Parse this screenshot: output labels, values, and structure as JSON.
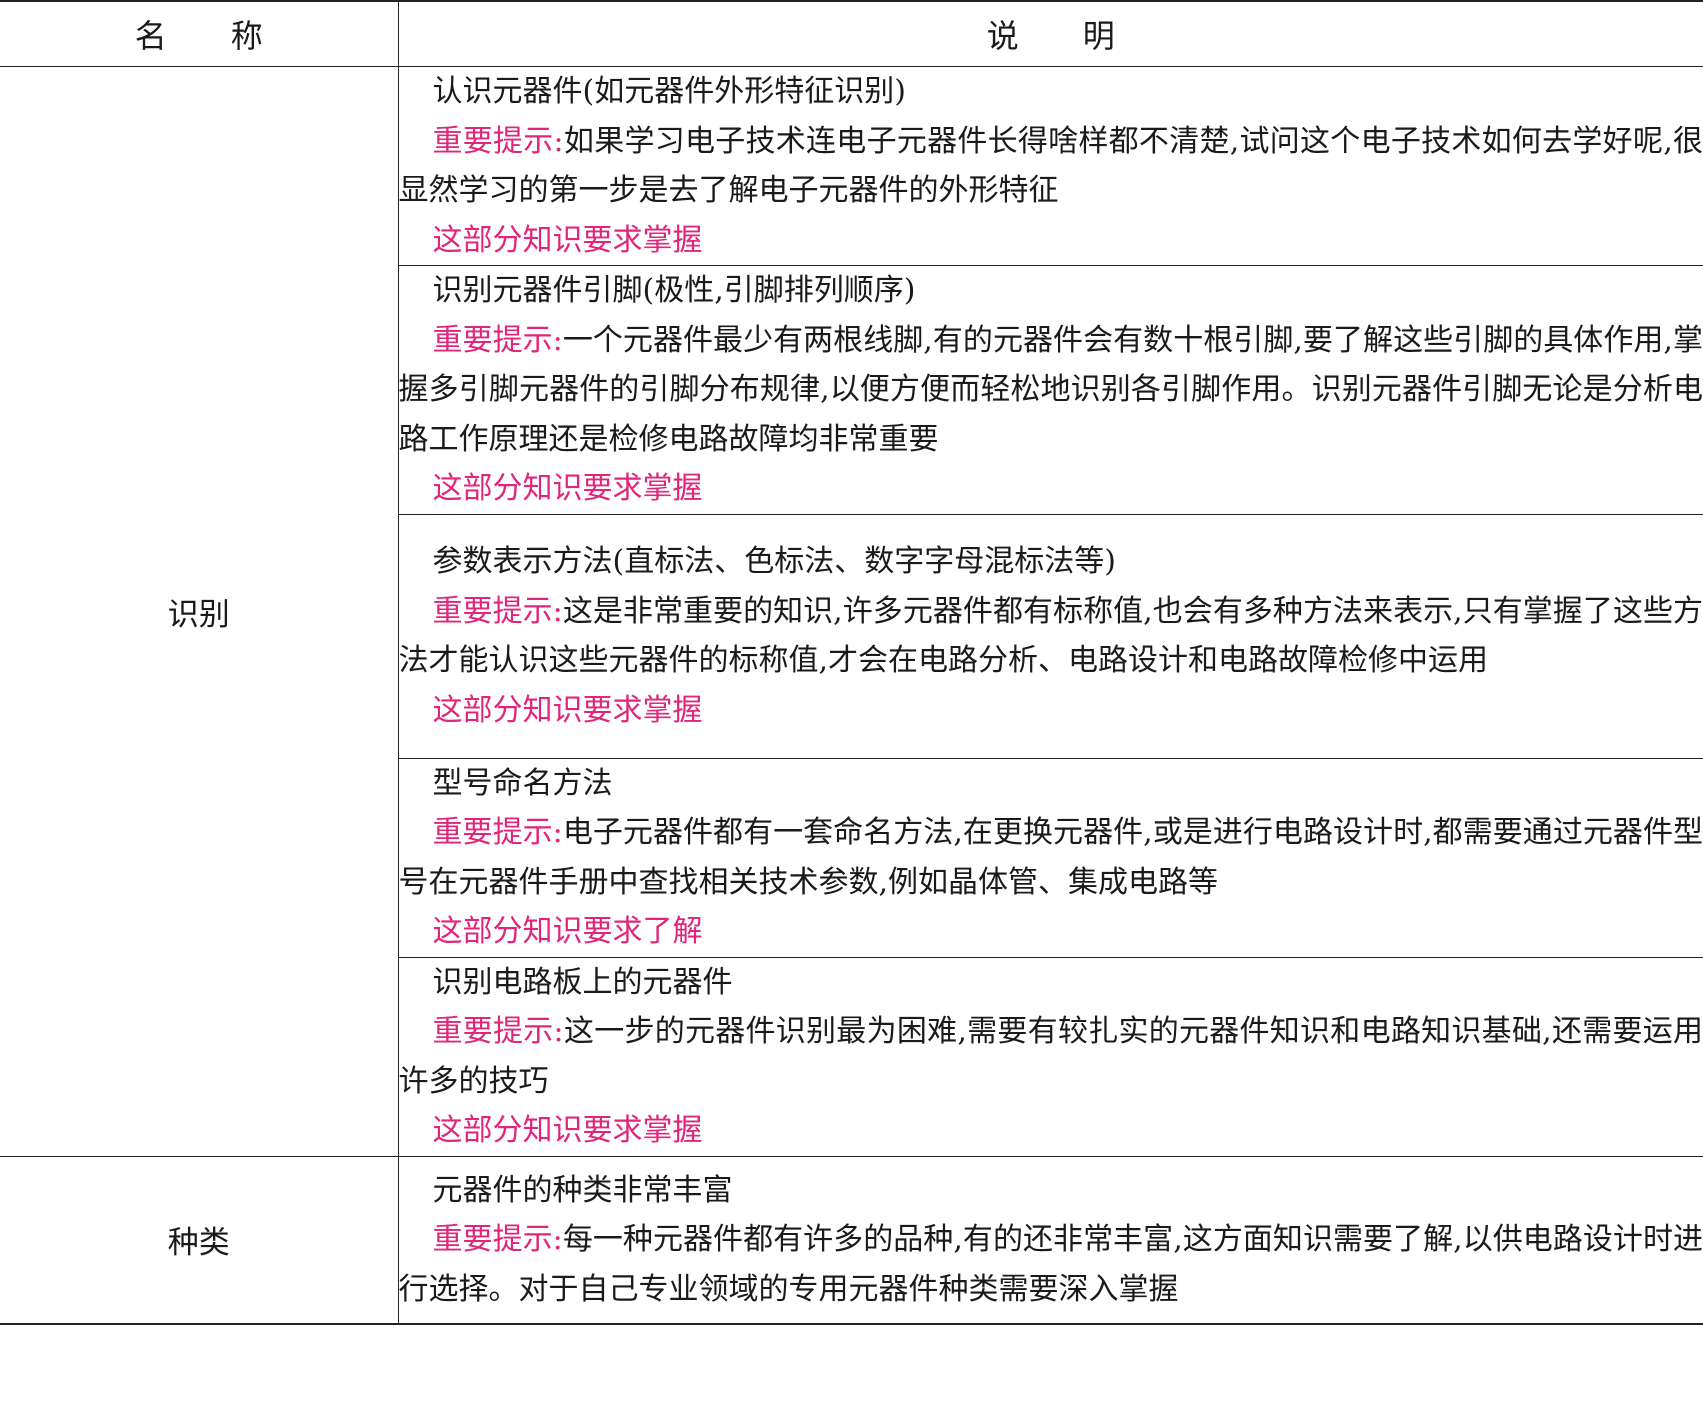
{
  "header": {
    "name_col": "名　　称",
    "desc_col": "说　　明"
  },
  "groups": [
    {
      "name": "识别",
      "items": [
        {
          "title": "认识元器件(如元器件外形特征识别)",
          "tip_label": "重要提示:",
          "tip_text": "如果学习电子技术连电子元器件长得啥样都不清楚,试问这个电子技术如何去学好呢,很显然学习的第一步是去了解电子元器件的外形特征",
          "requirement": "这部分知识要求掌握"
        },
        {
          "title": "识别元器件引脚(极性,引脚排列顺序)",
          "tip_label": "重要提示:",
          "tip_text": "一个元器件最少有两根线脚,有的元器件会有数十根引脚,要了解这些引脚的具体作用,掌握多引脚元器件的引脚分布规律,以便方便而轻松地识别各引脚作用。识别元器件引脚无论是分析电路工作原理还是检修电路故障均非常重要",
          "requirement": "这部分知识要求掌握"
        },
        {
          "title": "参数表示方法(直标法、色标法、数字字母混标法等)",
          "tip_label": "重要提示:",
          "tip_text": "这是非常重要的知识,许多元器件都有标称值,也会有多种方法来表示,只有掌握了这些方法才能认识这些元器件的标称值,才会在电路分析、电路设计和电路故障检修中运用",
          "requirement": "这部分知识要求掌握"
        },
        {
          "title": "型号命名方法",
          "tip_label": "重要提示:",
          "tip_text": "电子元器件都有一套命名方法,在更换元器件,或是进行电路设计时,都需要通过元器件型号在元器件手册中查找相关技术参数,例如晶体管、集成电路等",
          "requirement": "这部分知识要求了解"
        },
        {
          "title": "识别电路板上的元器件",
          "tip_label": "重要提示:",
          "tip_text": "这一步的元器件识别最为困难,需要有较扎实的元器件知识和电路知识基础,还需要运用许多的技巧",
          "requirement": "这部分知识要求掌握"
        }
      ]
    },
    {
      "name": "种类",
      "items": [
        {
          "title": "元器件的种类非常丰富",
          "tip_label": "重要提示:",
          "tip_text": "每一种元器件都有许多的品种,有的还非常丰富,这方面知识需要了解,以供电路设计时进行选择。对于自己专业领域的专用元器件种类需要深入掌握",
          "requirement": ""
        }
      ]
    }
  ],
  "colors": {
    "accent": "#e0257a",
    "text": "#1a1a1a",
    "border": "#222222"
  }
}
